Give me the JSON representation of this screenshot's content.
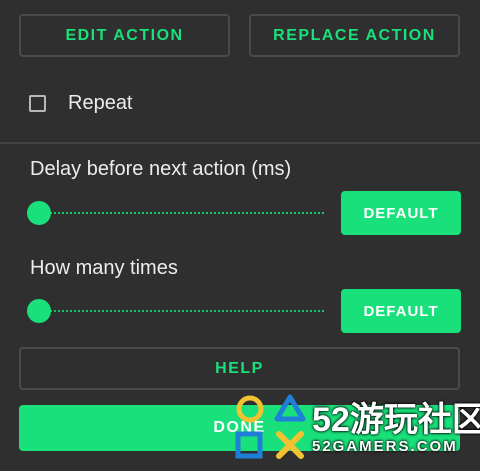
{
  "colors": {
    "accent": "#19e07a",
    "background": "#2f2f2f",
    "outline": "#4a4a4a",
    "text": "#ececec"
  },
  "top_buttons": {
    "edit_label": "EDIT ACTION",
    "replace_label": "REPLACE ACTION"
  },
  "repeat": {
    "label": "Repeat",
    "checked": false
  },
  "delay": {
    "label": "Delay before next action (ms)",
    "slider_value_fraction": 0,
    "default_label": "DEFAULT"
  },
  "times": {
    "label": "How many times",
    "slider_value_fraction": 0,
    "default_label": "DEFAULT"
  },
  "help_label": "HELP",
  "done_label": "DONE",
  "watermark": {
    "big": "52游玩社区",
    "small": "52GAMERS.COM"
  }
}
